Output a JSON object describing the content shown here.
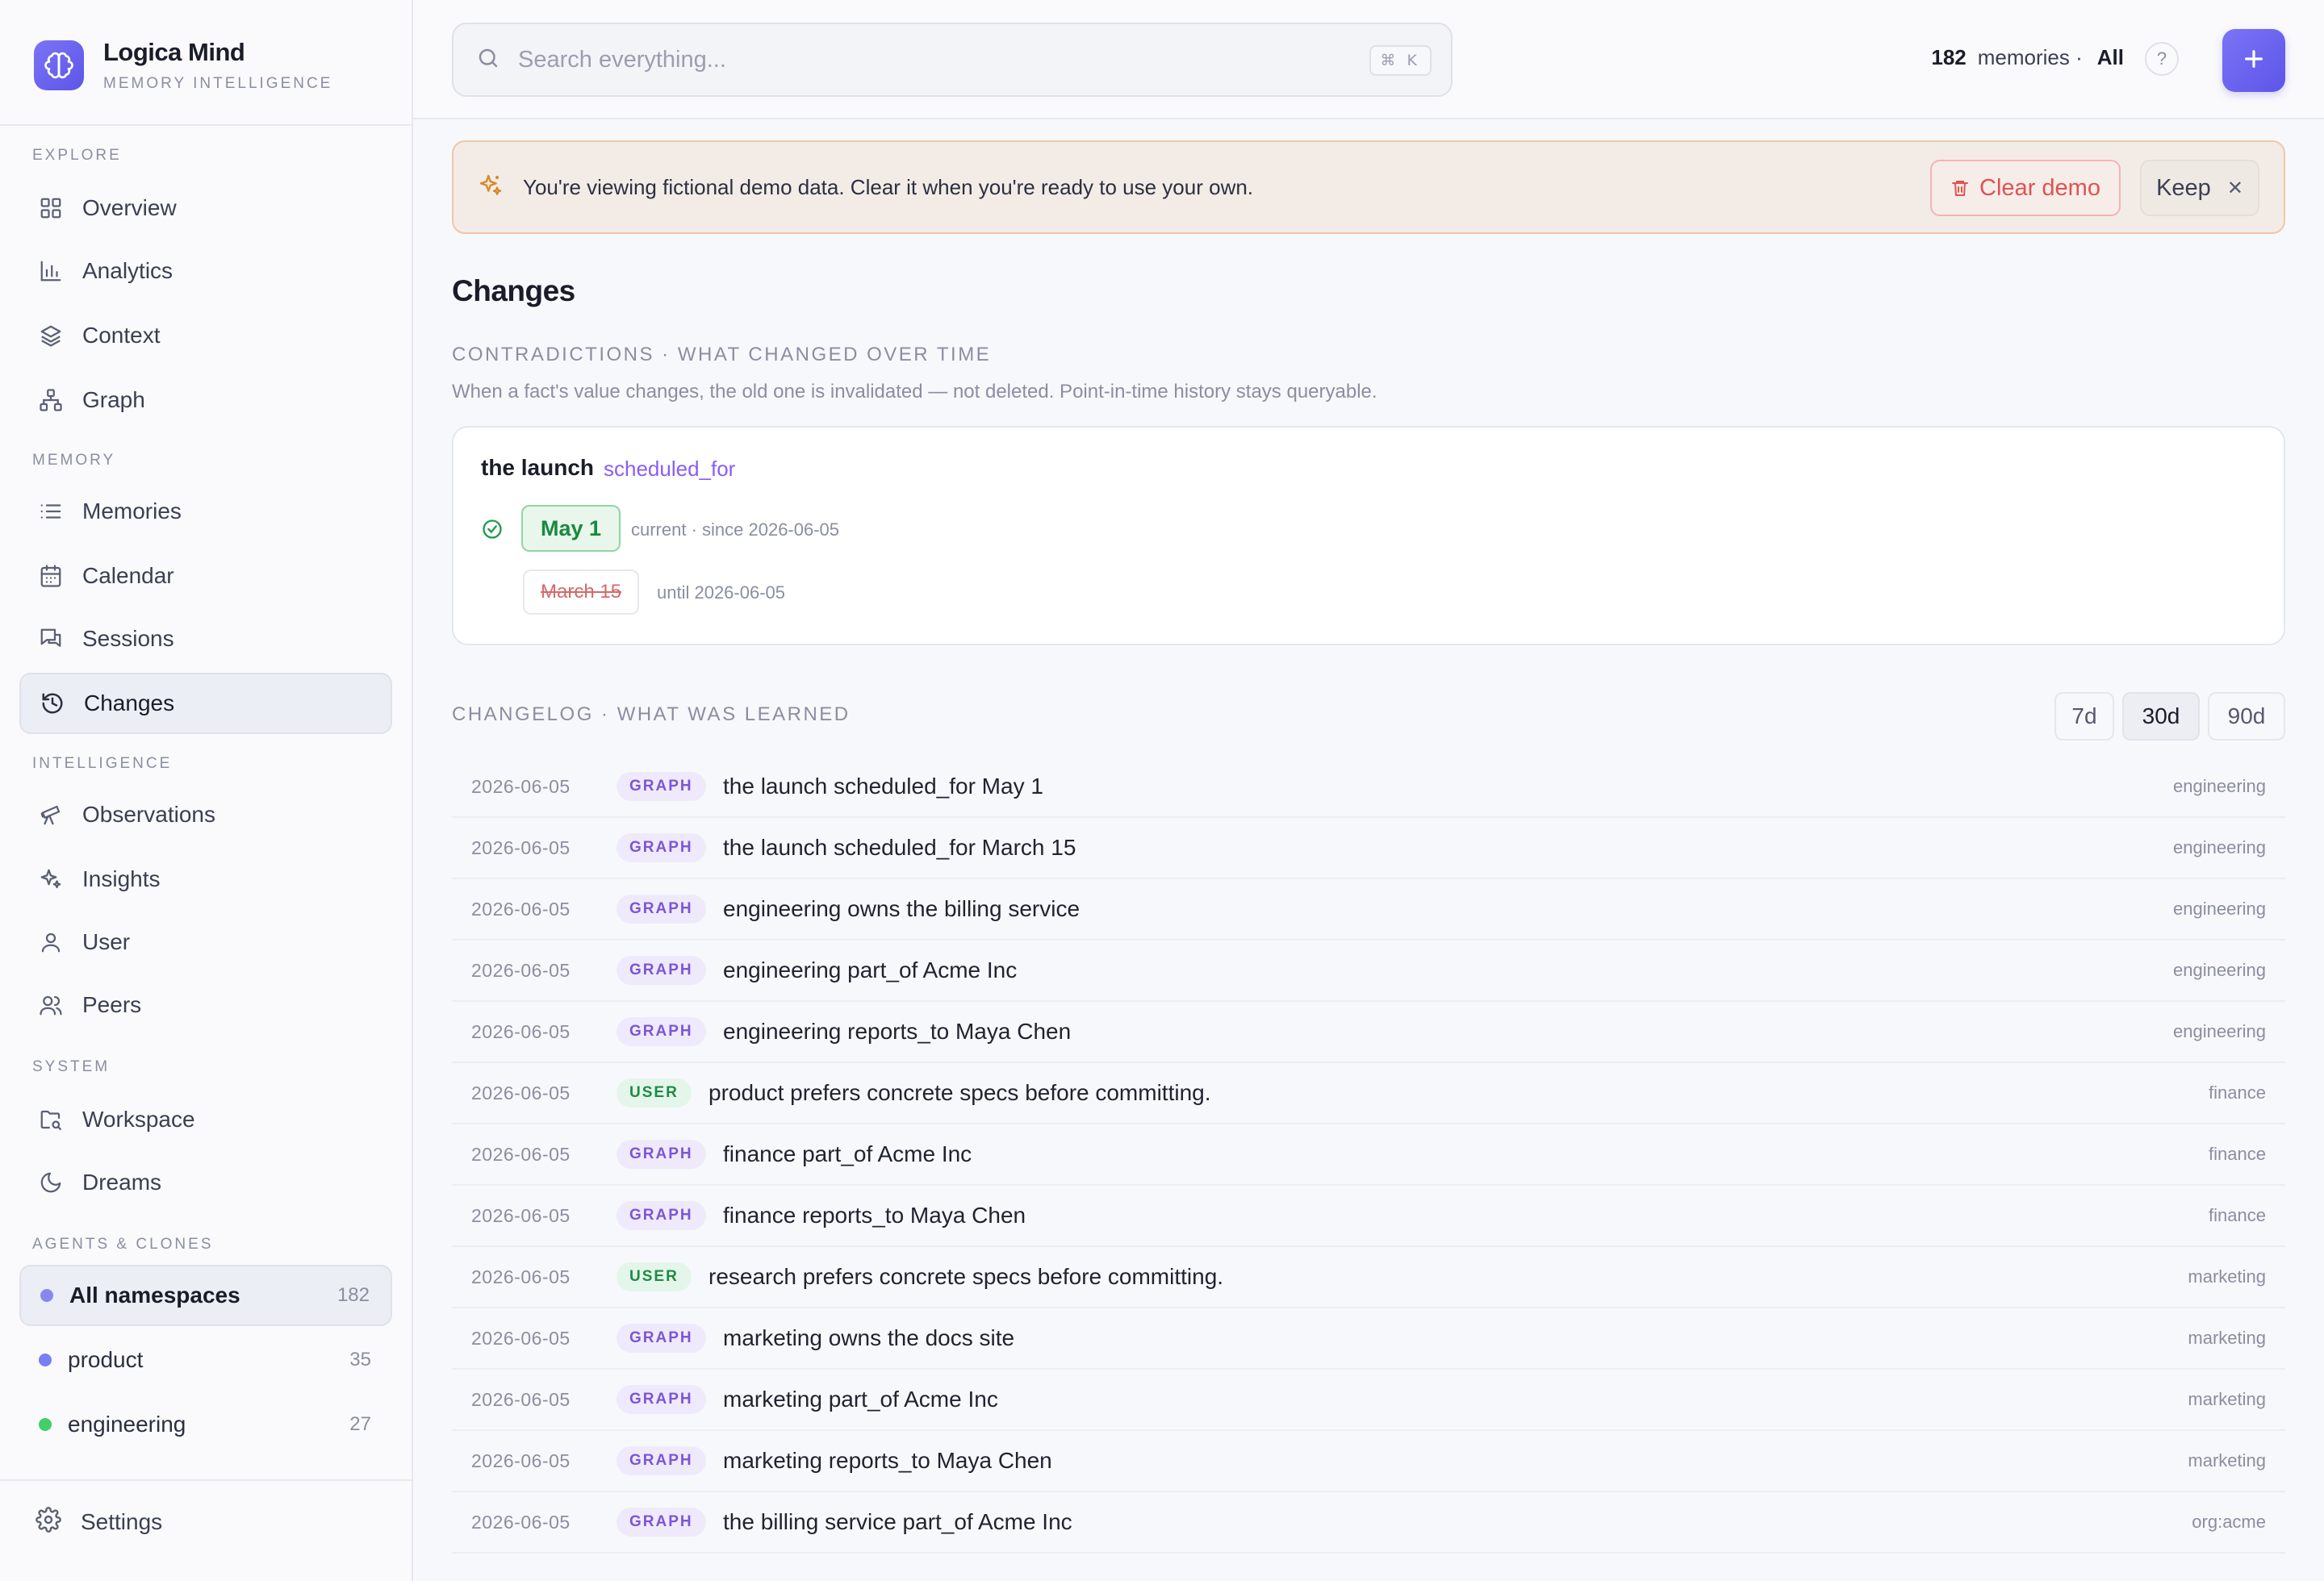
{
  "brand": {
    "title": "Logica Mind",
    "subtitle": "MEMORY INTELLIGENCE"
  },
  "sections": {
    "explore": "EXPLORE",
    "memory": "MEMORY",
    "intelligence": "INTELLIGENCE",
    "system": "SYSTEM",
    "agents": "AGENTS & CLONES"
  },
  "nav": {
    "overview": "Overview",
    "analytics": "Analytics",
    "context": "Context",
    "graph": "Graph",
    "memories": "Memories",
    "calendar": "Calendar",
    "sessions": "Sessions",
    "changes": "Changes",
    "observations": "Observations",
    "insights": "Insights",
    "user": "User",
    "peers": "Peers",
    "workspace": "Workspace",
    "dreams": "Dreams",
    "settings": "Settings"
  },
  "namespaces": [
    {
      "label": "All namespaces",
      "count": "182",
      "color": "#8a86f0"
    },
    {
      "label": "product",
      "count": "35",
      "color": "#7b7ef2"
    },
    {
      "label": "engineering",
      "count": "27",
      "color": "#3fd06a"
    }
  ],
  "search": {
    "placeholder": "Search everything...",
    "shortcut": "⌘ K"
  },
  "header": {
    "count": "182",
    "count_label": "memories ·",
    "scope": "All",
    "help": "?"
  },
  "banner": {
    "text": "You're viewing fictional demo data. Clear it when you're ready to use your own.",
    "clear": "Clear demo",
    "keep": "Keep"
  },
  "page": {
    "title": "Changes"
  },
  "contradictions": {
    "heading": "CONTRADICTIONS · WHAT CHANGED OVER TIME",
    "description": "When a fact's value changes, the old one is invalidated — not deleted. Point-in-time history stays queryable.",
    "subject": "the launch",
    "predicate": "scheduled_for",
    "current_value": "May 1",
    "current_meta": "current · since 2026-06-05",
    "old_value": "March 15",
    "old_meta": "until 2026-06-05"
  },
  "changelog": {
    "heading": "CHANGELOG · WHAT WAS LEARNED",
    "ranges": [
      "7d",
      "30d",
      "90d"
    ],
    "active_range": "30d",
    "rows": [
      {
        "date": "2026-06-05",
        "type": "GRAPH",
        "text": "the launch scheduled_for May 1",
        "ns": "engineering"
      },
      {
        "date": "2026-06-05",
        "type": "GRAPH",
        "text": "the launch scheduled_for March 15",
        "ns": "engineering"
      },
      {
        "date": "2026-06-05",
        "type": "GRAPH",
        "text": "engineering owns the billing service",
        "ns": "engineering"
      },
      {
        "date": "2026-06-05",
        "type": "GRAPH",
        "text": "engineering part_of Acme Inc",
        "ns": "engineering"
      },
      {
        "date": "2026-06-05",
        "type": "GRAPH",
        "text": "engineering reports_to Maya Chen",
        "ns": "engineering"
      },
      {
        "date": "2026-06-05",
        "type": "USER",
        "text": "product prefers concrete specs before committing.",
        "ns": "finance"
      },
      {
        "date": "2026-06-05",
        "type": "GRAPH",
        "text": "finance part_of Acme Inc",
        "ns": "finance"
      },
      {
        "date": "2026-06-05",
        "type": "GRAPH",
        "text": "finance reports_to Maya Chen",
        "ns": "finance"
      },
      {
        "date": "2026-06-05",
        "type": "USER",
        "text": "research prefers concrete specs before committing.",
        "ns": "marketing"
      },
      {
        "date": "2026-06-05",
        "type": "GRAPH",
        "text": "marketing owns the docs site",
        "ns": "marketing"
      },
      {
        "date": "2026-06-05",
        "type": "GRAPH",
        "text": "marketing part_of Acme Inc",
        "ns": "marketing"
      },
      {
        "date": "2026-06-05",
        "type": "GRAPH",
        "text": "marketing reports_to Maya Chen",
        "ns": "marketing"
      },
      {
        "date": "2026-06-05",
        "type": "GRAPH",
        "text": "the billing service part_of Acme Inc",
        "ns": "org:acme"
      }
    ]
  }
}
